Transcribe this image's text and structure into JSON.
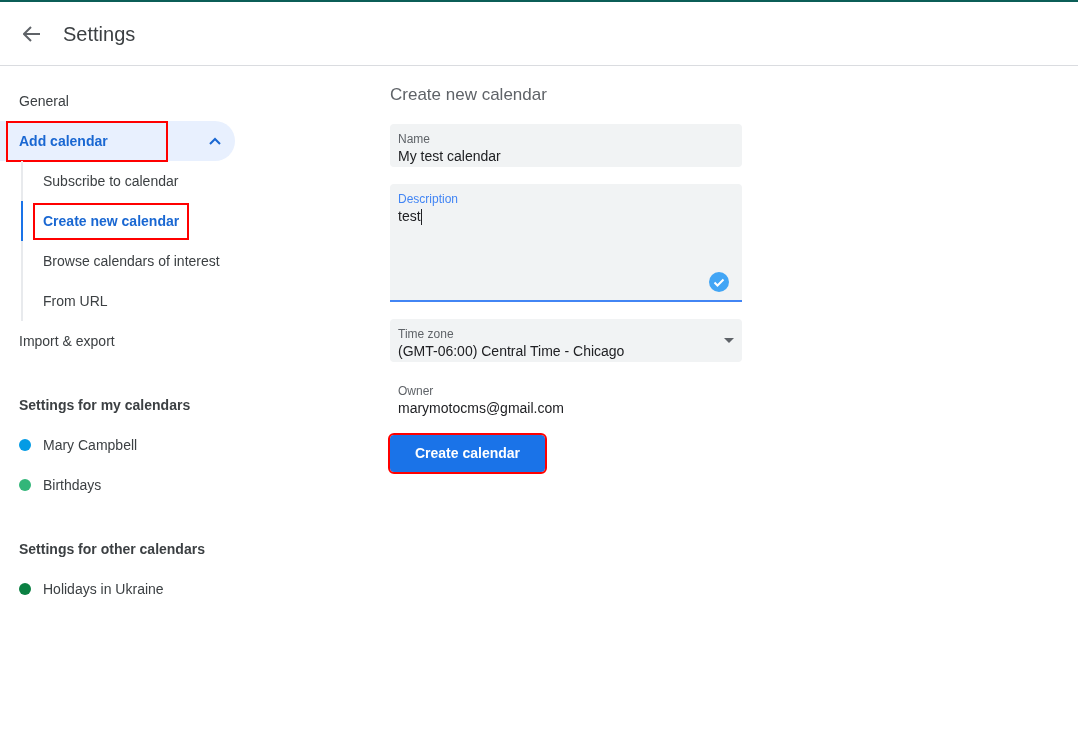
{
  "header": {
    "title": "Settings"
  },
  "sidebar": {
    "items": [
      {
        "label": "General",
        "selected": false,
        "highlighted": false
      },
      {
        "label": "Add calendar",
        "selected": true,
        "expanded": true,
        "highlighted": true,
        "children": [
          {
            "label": "Subscribe to calendar",
            "selected": false,
            "highlighted": false
          },
          {
            "label": "Create new calendar",
            "selected": true,
            "highlighted": true
          },
          {
            "label": "Browse calendars of interest",
            "selected": false,
            "highlighted": false
          },
          {
            "label": "From URL",
            "selected": false,
            "highlighted": false
          }
        ]
      },
      {
        "label": "Import & export",
        "selected": false,
        "highlighted": false
      }
    ],
    "sections": [
      {
        "heading": "Settings for my calendars",
        "calendars": [
          {
            "name": "Mary Campbell",
            "color": "#039be5"
          },
          {
            "name": "Birthdays",
            "color": "#33b679"
          }
        ]
      },
      {
        "heading": "Settings for other calendars",
        "calendars": [
          {
            "name": "Holidays in Ukraine",
            "color": "#0b8043"
          }
        ]
      }
    ]
  },
  "form": {
    "title": "Create new calendar",
    "fields": [
      {
        "kind": "text",
        "label": "Name",
        "value": "My test calendar",
        "focused": false
      },
      {
        "kind": "textarea",
        "label": "Description",
        "value": "test",
        "focused": true,
        "valid": true
      },
      {
        "kind": "select",
        "label": "Time zone",
        "value": "(GMT-06:00) Central Time - Chicago",
        "focused": false
      },
      {
        "kind": "static",
        "label": "Owner",
        "value": "marymotocms@gmail.com"
      }
    ],
    "button": {
      "label": "Create calendar",
      "highlighted": true
    }
  }
}
